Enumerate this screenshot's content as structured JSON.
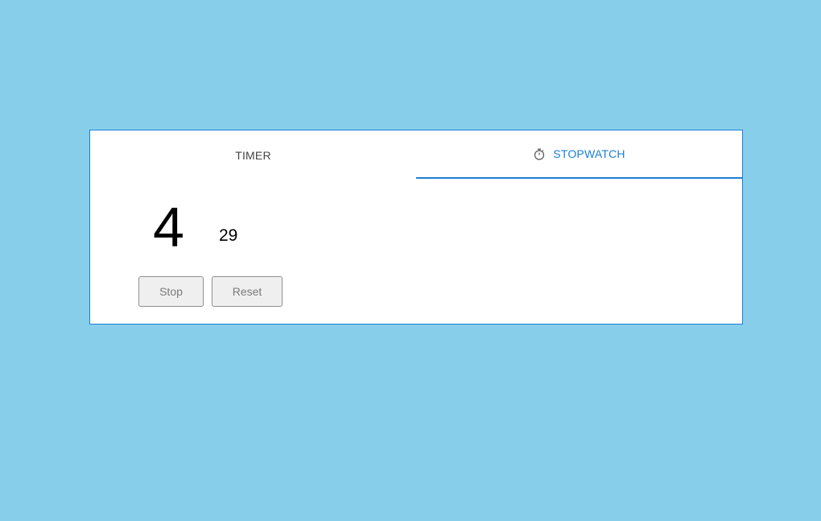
{
  "tabs": [
    {
      "label": "TIMER",
      "active": false
    },
    {
      "label": "STOPWATCH",
      "active": true,
      "icon": "stopwatch-icon"
    }
  ],
  "stopwatch": {
    "main_value": "4",
    "sub_value": "29"
  },
  "buttons": {
    "stop_label": "Stop",
    "reset_label": "Reset"
  },
  "colors": {
    "page_background": "#87ceeb",
    "accent": "#1a7fd6"
  }
}
